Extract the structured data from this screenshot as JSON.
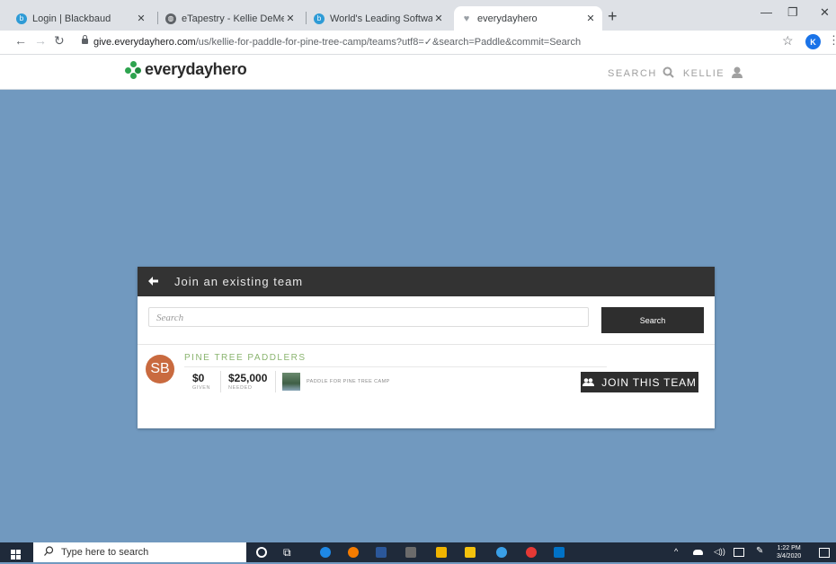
{
  "browser": {
    "tabs": [
      {
        "title": "Login | Blackbaud",
        "favicon": "blackbaud-icon",
        "color": "#2e9bd6"
      },
      {
        "title": "eTapestry - Kellie DeMers - Pine",
        "favicon": "globe-icon",
        "color": "#5f6368"
      },
      {
        "title": "World's Leading Software Compa",
        "favicon": "blackbaud-icon",
        "color": "#2e9bd6"
      },
      {
        "title": "everydayhero",
        "favicon": "heart-icon",
        "color": "#9aa0a6"
      }
    ],
    "url_host": "give.everydayhero.com",
    "url_path": "/us/kellie-for-paddle-for-pine-tree-camp/teams?utf8=✓&search=Paddle&commit=Search",
    "profile_initial": "K"
  },
  "site": {
    "logo_text": "everydayhero",
    "search_label": "SEARCH",
    "user_label": "KELLIE"
  },
  "panel": {
    "title": "Join an existing team",
    "search_placeholder": "Search",
    "search_button": "Search",
    "team": {
      "initials": "SB",
      "name": "PINE TREE PADDLERS",
      "given_value": "$0",
      "given_label": "GIVEN",
      "needed_value": "$25,000",
      "needed_label": "NEEDED",
      "campaign": "PADDLE FOR PINE TREE CAMP",
      "join_button": "JOIN THIS TEAM"
    }
  },
  "taskbar": {
    "search_placeholder": "Type here to search",
    "time": "1:22 PM",
    "date": "3/4/2020"
  },
  "colors": {
    "page_bg": "#7199bf",
    "brand_green": "#2ea44f",
    "team_name": "#8ab46f",
    "avatar": "#c96a3f",
    "dark_button": "#2e2e2e"
  }
}
